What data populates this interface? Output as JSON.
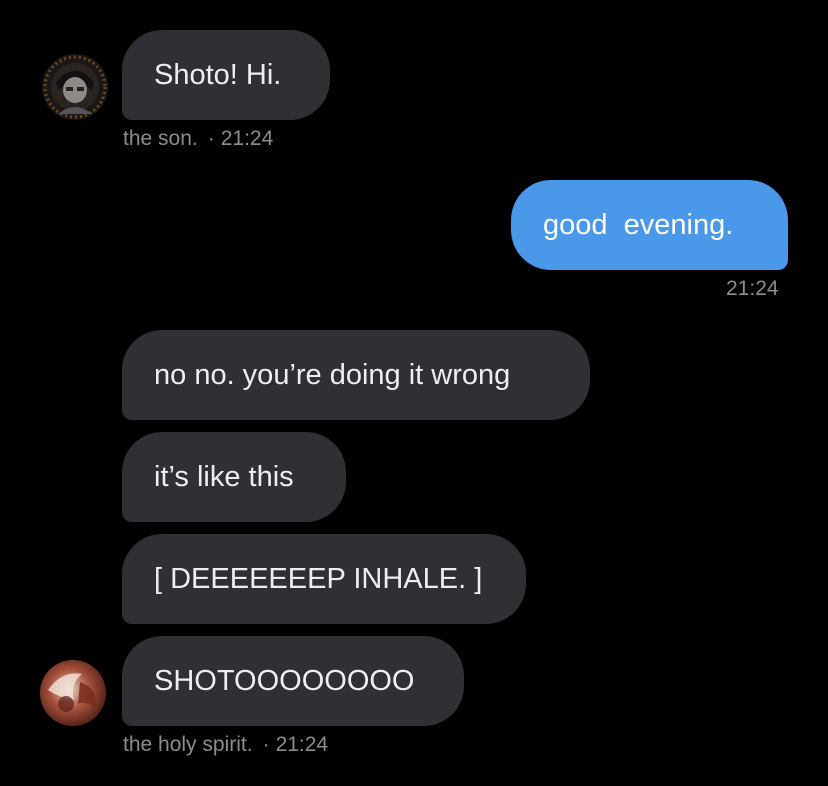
{
  "conversation": {
    "messages": [
      {
        "id": "m1",
        "direction": "incoming",
        "text": "Shoto! Hi."
      },
      {
        "id": "m2",
        "direction": "outgoing",
        "text": "good  evening."
      },
      {
        "id": "m3",
        "direction": "incoming",
        "text": "no no. you’re doing it wrong"
      },
      {
        "id": "m4",
        "direction": "incoming",
        "text": "it’s like this"
      },
      {
        "id": "m5",
        "direction": "incoming",
        "text": "[ DEEEEEEEP INHALE. ]"
      },
      {
        "id": "m6",
        "direction": "incoming",
        "text": "SHOTOOOOOOOO"
      }
    ],
    "meta": {
      "first": {
        "sender": "the son.",
        "separator": "·",
        "time": "21:24"
      },
      "outgoing": {
        "time": "21:24"
      },
      "last": {
        "sender": "the holy spirit.",
        "separator": "·",
        "time": "21:24"
      }
    },
    "avatars": {
      "son": {
        "icon": "user-avatar-icon"
      },
      "holy_spirit": {
        "icon": "user-avatar-icon"
      }
    }
  },
  "colors": {
    "background": "#000000",
    "incoming_bubble": "#2f3033",
    "outgoing_bubble": "#4a98e9",
    "meta_text": "#8b8c90"
  }
}
